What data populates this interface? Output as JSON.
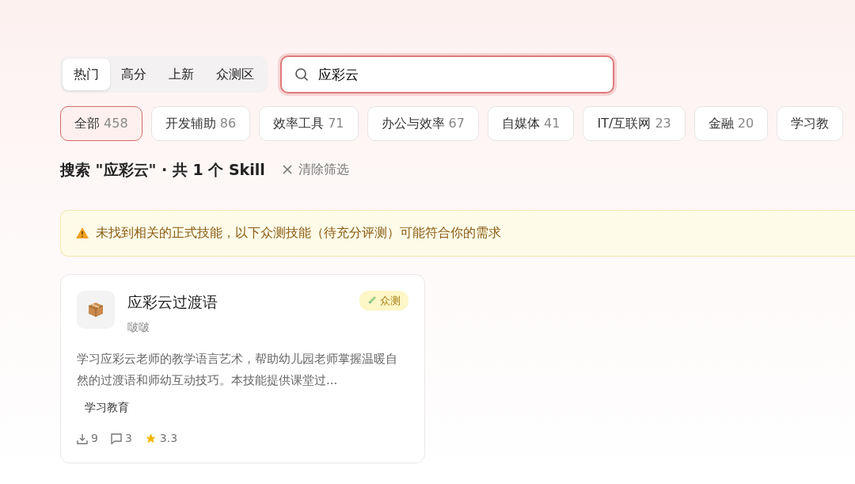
{
  "tabs": [
    {
      "label": "热门",
      "selected": true
    },
    {
      "label": "高分",
      "selected": false
    },
    {
      "label": "上新",
      "selected": false
    },
    {
      "label": "众测区",
      "selected": false
    }
  ],
  "search": {
    "value": "应彩云"
  },
  "categories": [
    {
      "label": "全部",
      "count": "458",
      "selected": true
    },
    {
      "label": "开发辅助",
      "count": "86",
      "selected": false
    },
    {
      "label": "效率工具",
      "count": "71",
      "selected": false
    },
    {
      "label": "办公与效率",
      "count": "67",
      "selected": false
    },
    {
      "label": "自媒体",
      "count": "41",
      "selected": false
    },
    {
      "label": "IT/互联网",
      "count": "23",
      "selected": false
    },
    {
      "label": "金融",
      "count": "20",
      "selected": false
    },
    {
      "label": "学习教",
      "selected": false
    }
  ],
  "result_heading": "搜索 \"应彩云\" · 共 1 个 Skill",
  "clear_filter": "清除筛选",
  "notice": "未找到相关的正式技能，以下众测技能（待充分评测）可能符合你的需求",
  "cards": [
    {
      "title": "应彩云过渡语",
      "author": "啵啵",
      "badge": "众测",
      "description": "学习应彩云老师的教学语言艺术，帮助幼儿园老师掌握温暖自然的过渡语和师幼互动技巧。本技能提供课堂过...",
      "tags": [
        "学习教育"
      ],
      "downloads": "9",
      "comments": "3",
      "rating": "3.3"
    }
  ]
}
